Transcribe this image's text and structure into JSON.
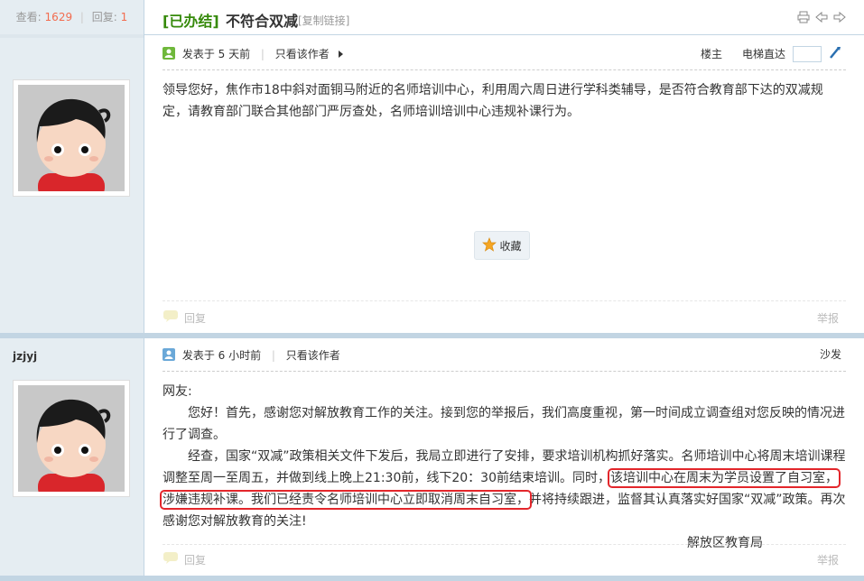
{
  "thread": {
    "views_label": "查看:",
    "views": "1629",
    "replies_label": "回复:",
    "replies": "1",
    "status_prefix": "[已办结]",
    "title": "不符合双减",
    "copy_link": "[复制链接]"
  },
  "post1": {
    "posted_at": "发表于 5 天前",
    "only_author": "只看该作者",
    "floor_label": "楼主",
    "jump_label": "电梯直达",
    "body": "领导您好，焦作市18中斜对面铜马附近的名师培训中心，利用周六周日进行学科类辅导，是否符合教育部下达的双减规定，请教育部门联合其他部门严厉查处，名师培训培训中心违规补课行为。",
    "favorite_label": "收藏",
    "reply_label": "回复",
    "report_label": "举报"
  },
  "post2": {
    "author": "jzjyj",
    "posted_at": "发表于 6 小时前",
    "only_author": "只看该作者",
    "floor_label": "沙发",
    "greeting": "网友:",
    "para1": "您好！首先，感谢您对解放教育工作的关注。接到您的举报后，我们高度重视，第一时间成立调查组对您反映的情况进行了调查。",
    "para2_a": "经查，国家“双减”政策相关文件下发后，我局立即进行了安排，要求培训机构抓好落实。名师培训中心将周末培训课程调整至周一至周五，并做到线上晚上21:30前，线下20：30前结束培训。同时，",
    "para2_hl1": "该培训中心在周末为学员设置了自习室，涉嫌违规补课。我们已经责令名师培训中心立即取消周末自习室，",
    "para2_c": "并将持续跟进，监督其认真落实好国家“双减”政策。再次感谢您对解放教育的关注!",
    "signature": "解放区教育局",
    "reply_label": "回复",
    "report_label": "举报"
  },
  "colors": {
    "accent_green": "#368a0b",
    "highlight_red": "#e3262b",
    "count_orange": "#f26c4f"
  }
}
